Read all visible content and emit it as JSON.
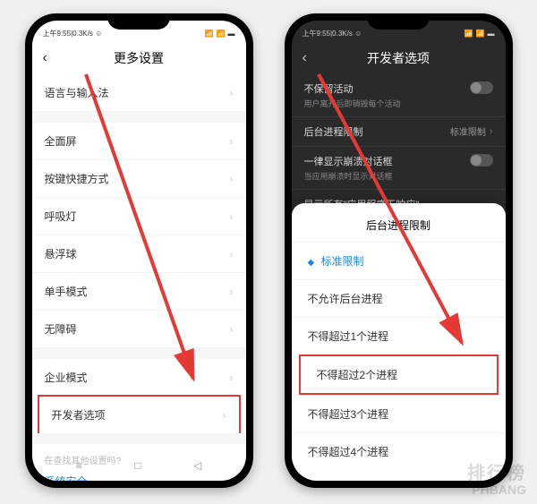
{
  "status": {
    "time": "上午9:55",
    "speed": "0.3K/s"
  },
  "phone1": {
    "title": "更多设置",
    "items": {
      "lang": "语言与输入法",
      "fullscreen": "全面屏",
      "shortcut": "按键快捷方式",
      "breathlight": "呼吸灯",
      "floatball": "悬浮球",
      "onehand": "单手模式",
      "accessibility": "无障碍",
      "enterprise": "企业模式",
      "developer": "开发者选项"
    },
    "search_hint": "在查找其他设置吗?",
    "system_security": "系统安全"
  },
  "phone2": {
    "title": "开发者选项",
    "dark_items": {
      "no_keep": {
        "label": "不保留活动",
        "sub": "用户离开后即销毁每个活动"
      },
      "bg_limit": {
        "label": "后台进程限制",
        "value": "标准限制"
      },
      "crash_dialog": {
        "label": "一律显示崩溃对话框",
        "sub": "当应用崩溃时显示对话框"
      },
      "anr": "显示所有\"应用程序无响应\""
    },
    "sheet": {
      "title": "后台进程限制",
      "options": {
        "standard": "标准限制",
        "none": "不允许后台进程",
        "max1": "不得超过1个进程",
        "max2": "不得超过2个进程",
        "max3": "不得超过3个进程",
        "max4": "不得超过4个进程"
      }
    }
  },
  "watermark": {
    "cn": "排行榜",
    "en": "PHBANG"
  }
}
